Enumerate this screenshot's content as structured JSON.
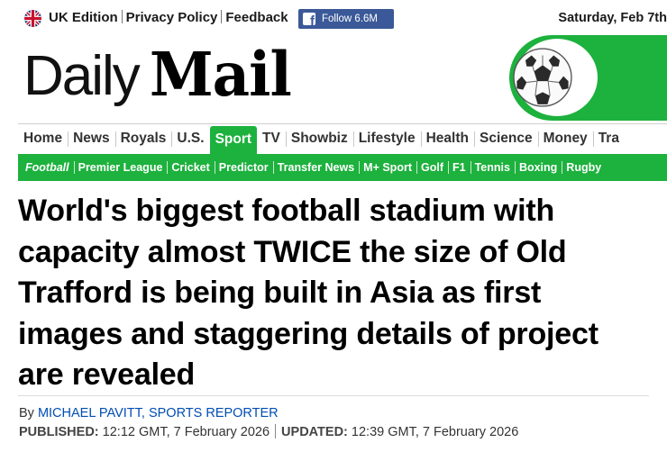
{
  "topbar": {
    "edition_label": "UK Edition",
    "privacy_label": "Privacy Policy",
    "feedback_label": "Feedback",
    "facebook_follow_label": "Follow 6.6M",
    "date_label": "Saturday, Feb 7th"
  },
  "masthead": {
    "logo_daily": "Daily",
    "logo_mail": "Mail",
    "section_icon": "football-icon",
    "accent_color": "#1db13d"
  },
  "main_nav": {
    "items": [
      "Home",
      "News",
      "Royals",
      "U.S.",
      "Sport",
      "TV",
      "Showbiz",
      "Lifestyle",
      "Health",
      "Science",
      "Money",
      "Tra"
    ],
    "active": "Sport"
  },
  "sub_nav": {
    "items": [
      "Football",
      "Premier League",
      "Cricket",
      "Predictor",
      "Transfer News",
      "M+ Sport",
      "Golf",
      "F1",
      "Tennis",
      "Boxing",
      "Rugby"
    ],
    "current": "Football"
  },
  "article": {
    "headline": "World's biggest football stadium with capacity almost TWICE the size of Old Trafford is being built in Asia as first images and staggering details of project are revealed",
    "by_prefix": "By",
    "author": "MICHAEL PAVITT, SPORTS REPORTER",
    "published_label": "PUBLISHED:",
    "published_value": "12:12 GMT, 7 February 2026",
    "updated_label": "UPDATED:",
    "updated_value": "12:39 GMT, 7 February 2026"
  }
}
